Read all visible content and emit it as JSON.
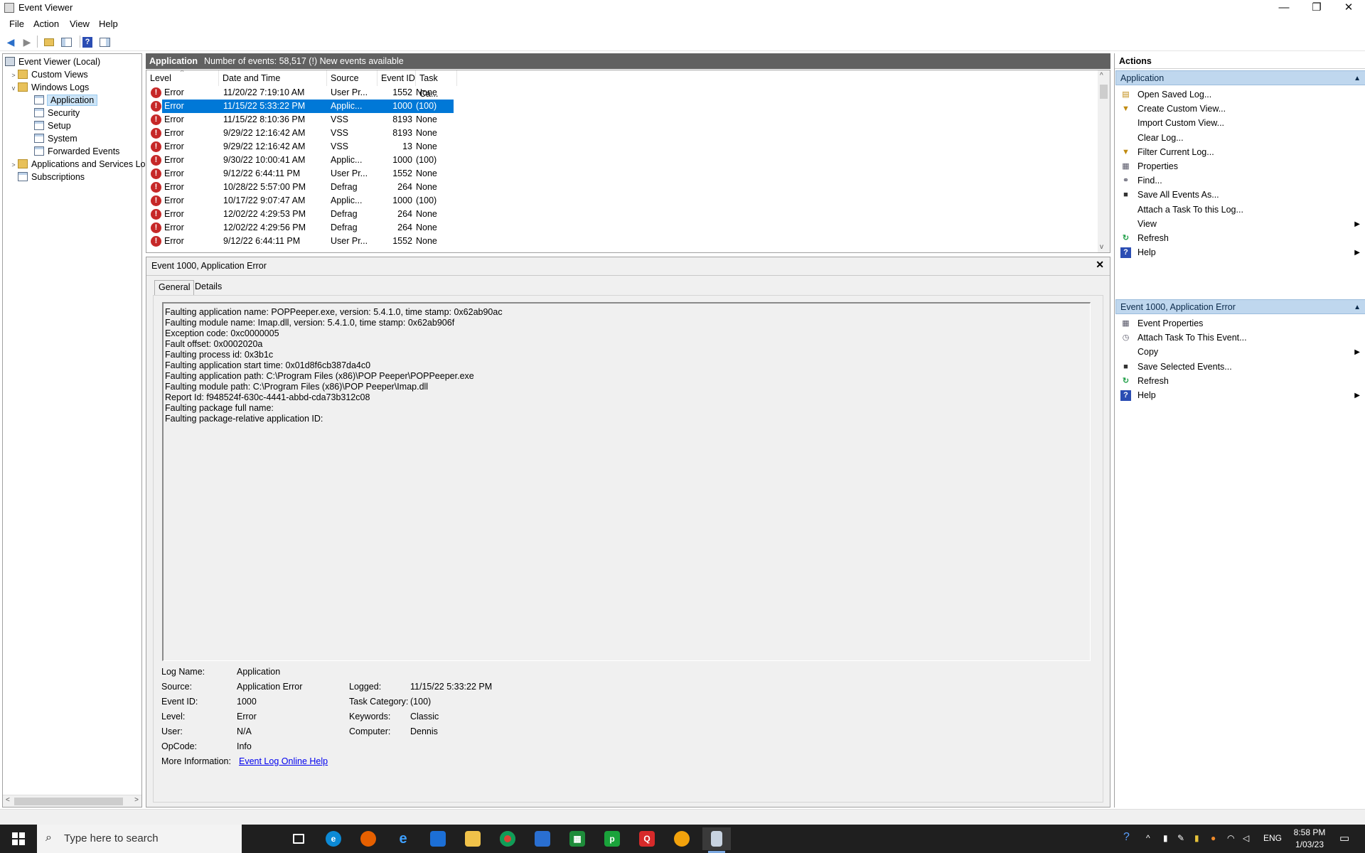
{
  "window": {
    "title": "Event Viewer",
    "minimize": "—",
    "restore": "❐",
    "close": "✕"
  },
  "menu": [
    "File",
    "Action",
    "View",
    "Help"
  ],
  "tree": {
    "root": "Event Viewer (Local)",
    "items": [
      {
        "label": "Custom Views"
      },
      {
        "label": "Windows Logs"
      },
      {
        "label": "Application"
      },
      {
        "label": "Security"
      },
      {
        "label": "Setup"
      },
      {
        "label": "System"
      },
      {
        "label": "Forwarded Events"
      },
      {
        "label": "Applications and Services Lo"
      },
      {
        "label": "Subscriptions"
      }
    ]
  },
  "center": {
    "title": "Application",
    "info": "Number of events: 58,517 (!) New events available"
  },
  "list": {
    "columns": [
      "Level",
      "Date and Time",
      "Source",
      "Event ID",
      "Task Ca..."
    ],
    "rows": [
      {
        "level": "Error",
        "date": "11/20/22 7:19:10 AM",
        "source": "User Pr...",
        "id": "1552",
        "task": "None"
      },
      {
        "level": "Error",
        "date": "11/15/22 5:33:22 PM",
        "source": "Applic...",
        "id": "1000",
        "task": "(100)"
      },
      {
        "level": "Error",
        "date": "11/15/22 8:10:36 PM",
        "source": "VSS",
        "id": "8193",
        "task": "None"
      },
      {
        "level": "Error",
        "date": "9/29/22 12:16:42 AM",
        "source": "VSS",
        "id": "8193",
        "task": "None"
      },
      {
        "level": "Error",
        "date": "9/29/22 12:16:42 AM",
        "source": "VSS",
        "id": "13",
        "task": "None"
      },
      {
        "level": "Error",
        "date": "9/30/22 10:00:41 AM",
        "source": "Applic...",
        "id": "1000",
        "task": "(100)"
      },
      {
        "level": "Error",
        "date": "9/12/22 6:44:11 PM",
        "source": "User Pr...",
        "id": "1552",
        "task": "None"
      },
      {
        "level": "Error",
        "date": "10/28/22 5:57:00 PM",
        "source": "Defrag",
        "id": "264",
        "task": "None"
      },
      {
        "level": "Error",
        "date": "10/17/22 9:07:47 AM",
        "source": "Applic...",
        "id": "1000",
        "task": "(100)"
      },
      {
        "level": "Error",
        "date": "12/02/22 4:29:53 PM",
        "source": "Defrag",
        "id": "264",
        "task": "None"
      },
      {
        "level": "Error",
        "date": "12/02/22 4:29:56 PM",
        "source": "Defrag",
        "id": "264",
        "task": "None"
      },
      {
        "level": "Error",
        "date": "9/12/22 6:44:11 PM",
        "source": "User Pr...",
        "id": "1552",
        "task": "None"
      }
    ]
  },
  "detail": {
    "title": "Event 1000, Application Error",
    "tabs": [
      "General",
      "Details"
    ],
    "description": [
      "Faulting application name: POPPeeper.exe, version: 5.4.1.0, time stamp: 0x62ab90ac",
      "Faulting module name: Imap.dll, version: 5.4.1.0, time stamp: 0x62ab906f",
      "Exception code: 0xc0000005",
      "Fault offset: 0x0002020a",
      "Faulting process id: 0x3b1c",
      "Faulting application start time: 0x01d8f6cb387da4c0",
      "Faulting application path: C:\\Program Files (x86)\\POP Peeper\\POPPeeper.exe",
      "Faulting module path: C:\\Program Files (x86)\\POP Peeper\\Imap.dll",
      "Report Id: f948524f-630c-4441-abbd-cda73b312c08",
      "Faulting package full name: ",
      "Faulting package-relative application ID: "
    ],
    "props": {
      "log_name_label": "Log Name:",
      "log_name": "Application",
      "source_label": "Source:",
      "source": "Application Error",
      "logged_label": "Logged:",
      "logged": "11/15/22 5:33:22 PM",
      "event_id_label": "Event ID:",
      "event_id": "1000",
      "task_label": "Task Category:",
      "task": "(100)",
      "level_label": "Level:",
      "level": "Error",
      "keywords_label": "Keywords:",
      "keywords": "Classic",
      "user_label": "User:",
      "user": "N/A",
      "computer_label": "Computer:",
      "computer": "Dennis",
      "opcode_label": "OpCode:",
      "opcode": "Info",
      "more_label": "More Information:",
      "more_link": "Event Log Online Help"
    }
  },
  "actions": {
    "header": "Actions",
    "section1": "Application",
    "items1": [
      {
        "label": "Open Saved Log...",
        "icon": "open-log-icon"
      },
      {
        "label": "Create Custom View...",
        "icon": "filter-icon"
      },
      {
        "label": "Import Custom View...",
        "icon": ""
      },
      {
        "label": "Clear Log...",
        "icon": ""
      },
      {
        "label": "Filter Current Log...",
        "icon": "filter-icon"
      },
      {
        "label": "Properties",
        "icon": "properties-icon"
      },
      {
        "label": "Find...",
        "icon": "find-icon"
      },
      {
        "label": "Save All Events As...",
        "icon": "save-icon"
      },
      {
        "label": "Attach a Task To this Log...",
        "icon": ""
      },
      {
        "label": "View",
        "icon": "",
        "submenu": true
      },
      {
        "label": "Refresh",
        "icon": "refresh-icon"
      },
      {
        "label": "Help",
        "icon": "help-icon",
        "submenu": true
      }
    ],
    "section2": "Event 1000, Application Error",
    "items2": [
      {
        "label": "Event Properties",
        "icon": "properties-icon"
      },
      {
        "label": "Attach Task To This Event...",
        "icon": "task-icon"
      },
      {
        "label": "Copy",
        "icon": "",
        "submenu": true
      },
      {
        "label": "Save Selected Events...",
        "icon": "save-icon"
      },
      {
        "label": "Refresh",
        "icon": "refresh-icon"
      },
      {
        "label": "Help",
        "icon": "help-icon",
        "submenu": true
      }
    ]
  },
  "taskbar": {
    "search_placeholder": "Type here to search",
    "lang": "ENG",
    "time": "8:58 PM",
    "date": "1/03/23"
  }
}
